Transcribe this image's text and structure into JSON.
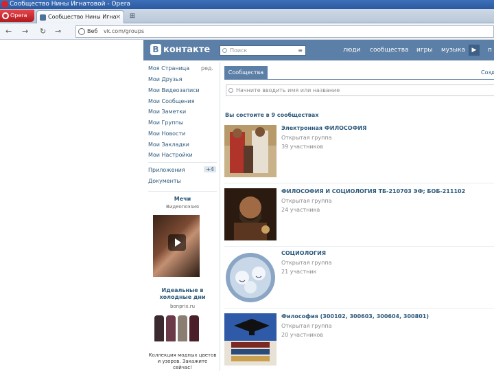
{
  "browser": {
    "window_title": "Сообщество Нины Игнатовой - Opera",
    "menu_label": "Opera",
    "tab_title": "Сообщество Нины Игна",
    "address_prefix": "Веб",
    "address_url": "vk.com/groups"
  },
  "vk": {
    "logo_text": "контакте",
    "logo_badge": "В",
    "search_placeholder": "Поиск",
    "nav": [
      "люди",
      "сообщества",
      "игры",
      "музыка"
    ],
    "nav_overflow": "п"
  },
  "sidebar": {
    "items": [
      "Моя Страница",
      "Мои Друзья",
      "Мои Видеозаписи",
      "Мои Сообщения",
      "Мои Заметки",
      "Мои Группы",
      "Мои Новости",
      "Мои Закладки",
      "Мои Настройки"
    ],
    "edit_label": "ред.",
    "apps_label": "Приложения",
    "apps_badge": "+4",
    "docs_label": "Документы",
    "ad1": {
      "title": "Мечи",
      "subtitle": "Видеопоэзия"
    },
    "ad2": {
      "title": "Идеальные в холодные дни",
      "domain": "bonprix.ru"
    },
    "ad3": {
      "text": "Коллекция модных цветов и узоров. Закажите сейчас!"
    }
  },
  "main": {
    "tab_active": "Сообщества",
    "tab_right": "Созда",
    "search_placeholder": "Начните вводить имя или название",
    "count_text": "Вы состоите в 9 сообществах",
    "groups": [
      {
        "name": "Электронная ФИЛОСОФИЯ",
        "type": "Открытая группа",
        "members": "39 участников"
      },
      {
        "name": "ФИЛОСОФИЯ И СОЦИОЛОГИЯ ТБ-210703 ЭФ; БОБ-211102",
        "type": "Открытая группа",
        "members": "24 участника"
      },
      {
        "name": "СОЦИОЛОГИЯ",
        "type": "Открытая группа",
        "members": "21 участник"
      },
      {
        "name": "Философия (300102, 300603, 300604, 300801)",
        "type": "Открытая группа",
        "members": "20 участников"
      }
    ]
  },
  "colors": {
    "vk_blue": "#5b7fa6",
    "link": "#2b587a"
  }
}
